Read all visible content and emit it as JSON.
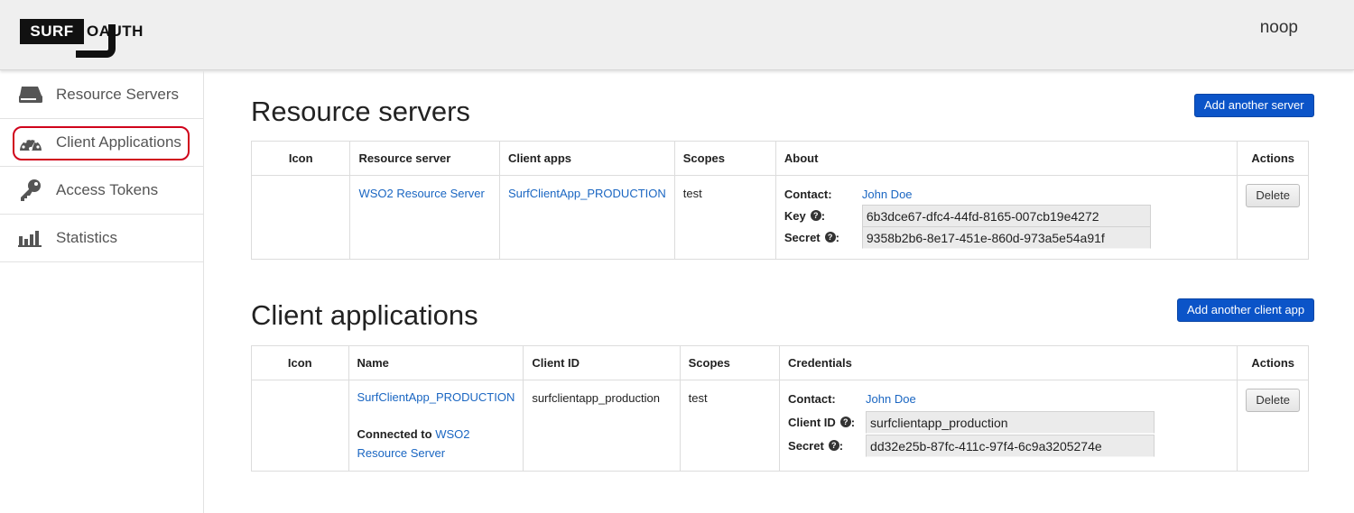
{
  "header": {
    "logo_left": "SURF",
    "logo_right": "OAUTH",
    "user": "noop"
  },
  "sidebar": {
    "items": [
      {
        "label": "Resource Servers",
        "icon": "server-icon"
      },
      {
        "label": "Client Applications",
        "icon": "dashboard-icon",
        "highlighted": true
      },
      {
        "label": "Access Tokens",
        "icon": "key-icon"
      },
      {
        "label": "Statistics",
        "icon": "bar-chart-icon"
      }
    ],
    "highlight_color": "#d0021b"
  },
  "resource_servers": {
    "title": "Resource servers",
    "add_button": "Add another server",
    "columns": [
      "Icon",
      "Resource server",
      "Client apps",
      "Scopes",
      "About",
      "Actions"
    ],
    "rows": [
      {
        "name": "WSO2 Resource Server",
        "client_apps": "SurfClientApp_PRODUCTION",
        "scopes": "test",
        "contact_label": "Contact:",
        "contact": "John Doe",
        "key_label": "Key",
        "key": "6b3dce67-dfc4-44fd-8165-007cb19e4272",
        "secret_label": "Secret",
        "secret": "9358b2b6-8e17-451e-860d-973a5e54a91f",
        "delete": "Delete"
      }
    ]
  },
  "client_applications": {
    "title": "Client applications",
    "add_button": "Add another client app",
    "columns": [
      "Icon",
      "Name",
      "Client ID",
      "Scopes",
      "Credentials",
      "Actions"
    ],
    "rows": [
      {
        "name": "SurfClientApp_PRODUCTION",
        "connected_label": "Connected to",
        "connected_server": "WSO2 Resource Server",
        "client_id": "surfclientapp_production",
        "scopes": "test",
        "contact_label": "Contact:",
        "contact": "John Doe",
        "client_id_label": "Client ID",
        "client_id_value": "surfclientapp_production",
        "secret_label": "Secret",
        "secret": "dd32e25b-87fc-411c-97f4-6c9a3205274e",
        "delete": "Delete"
      }
    ]
  },
  "colors": {
    "primary_button": "#0b54c8",
    "link": "#1a66c2",
    "header_bg": "#efefef"
  }
}
